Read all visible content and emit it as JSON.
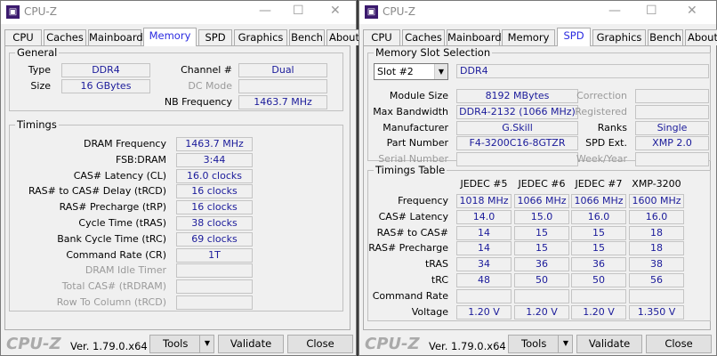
{
  "left": {
    "title": "CPU-Z",
    "tabs": [
      "CPU",
      "Caches",
      "Mainboard",
      "Memory",
      "SPD",
      "Graphics",
      "Bench",
      "About"
    ],
    "active_tab": "Memory",
    "general": {
      "label": "General",
      "type_label": "Type",
      "type": "DDR4",
      "size_label": "Size",
      "size": "16 GBytes",
      "channel_label": "Channel #",
      "channel": "Dual",
      "dc_label": "DC Mode",
      "dc": "",
      "nb_label": "NB Frequency",
      "nb": "1463.7 MHz"
    },
    "timings": {
      "label": "Timings",
      "rows": [
        {
          "label": "DRAM Frequency",
          "value": "1463.7 MHz",
          "disabled": false
        },
        {
          "label": "FSB:DRAM",
          "value": "3:44",
          "disabled": false
        },
        {
          "label": "CAS# Latency (CL)",
          "value": "16.0 clocks",
          "disabled": false
        },
        {
          "label": "RAS# to CAS# Delay (tRCD)",
          "value": "16 clocks",
          "disabled": false
        },
        {
          "label": "RAS# Precharge (tRP)",
          "value": "16 clocks",
          "disabled": false
        },
        {
          "label": "Cycle Time (tRAS)",
          "value": "38 clocks",
          "disabled": false
        },
        {
          "label": "Bank Cycle Time (tRC)",
          "value": "69 clocks",
          "disabled": false
        },
        {
          "label": "Command Rate (CR)",
          "value": "1T",
          "disabled": false
        },
        {
          "label": "DRAM Idle Timer",
          "value": "",
          "disabled": true
        },
        {
          "label": "Total CAS# (tRDRAM)",
          "value": "",
          "disabled": true
        },
        {
          "label": "Row To Column (tRCD)",
          "value": "",
          "disabled": true
        }
      ]
    },
    "footer": {
      "logo": "CPU-Z",
      "version": "Ver. 1.79.0.x64",
      "tools": "Tools",
      "validate": "Validate",
      "close": "Close"
    }
  },
  "right": {
    "title": "CPU-Z",
    "tabs": [
      "CPU",
      "Caches",
      "Mainboard",
      "Memory",
      "SPD",
      "Graphics",
      "Bench",
      "About"
    ],
    "active_tab": "SPD",
    "slot": {
      "label": "Memory Slot Selection",
      "selected": "Slot #2",
      "type": "DDR4",
      "left_rows": [
        {
          "label": "Module Size",
          "value": "8192 MBytes",
          "disabled": false
        },
        {
          "label": "Max Bandwidth",
          "value": "DDR4-2132 (1066 MHz)",
          "disabled": false
        },
        {
          "label": "Manufacturer",
          "value": "G.Skill",
          "disabled": false
        },
        {
          "label": "Part Number",
          "value": "F4-3200C16-8GTZR",
          "disabled": false
        },
        {
          "label": "Serial Number",
          "value": "",
          "disabled": true
        }
      ],
      "right_rows": [
        {
          "label": "Correction",
          "value": "",
          "disabled": true
        },
        {
          "label": "Registered",
          "value": "",
          "disabled": true
        },
        {
          "label": "Ranks",
          "value": "Single",
          "disabled": false
        },
        {
          "label": "SPD Ext.",
          "value": "XMP 2.0",
          "disabled": false
        },
        {
          "label": "Week/Year",
          "value": "",
          "disabled": true
        }
      ]
    },
    "table": {
      "label": "Timings Table",
      "columns": [
        "JEDEC #5",
        "JEDEC #6",
        "JEDEC #7",
        "XMP-3200"
      ],
      "rows": [
        {
          "label": "Frequency",
          "values": [
            "1018 MHz",
            "1066 MHz",
            "1066 MHz",
            "1600 MHz"
          ]
        },
        {
          "label": "CAS# Latency",
          "values": [
            "14.0",
            "15.0",
            "16.0",
            "16.0"
          ]
        },
        {
          "label": "RAS# to CAS#",
          "values": [
            "14",
            "15",
            "15",
            "18"
          ]
        },
        {
          "label": "RAS# Precharge",
          "values": [
            "14",
            "15",
            "15",
            "18"
          ]
        },
        {
          "label": "tRAS",
          "values": [
            "34",
            "36",
            "36",
            "38"
          ]
        },
        {
          "label": "tRC",
          "values": [
            "48",
            "50",
            "50",
            "56"
          ]
        },
        {
          "label": "Command Rate",
          "values": [
            "",
            "",
            "",
            ""
          ]
        },
        {
          "label": "Voltage",
          "values": [
            "1.20 V",
            "1.20 V",
            "1.20 V",
            "1.350 V"
          ]
        }
      ]
    },
    "footer": {
      "logo": "CPU-Z",
      "version": "Ver. 1.79.0.x64",
      "tools": "Tools",
      "validate": "Validate",
      "close": "Close"
    }
  }
}
